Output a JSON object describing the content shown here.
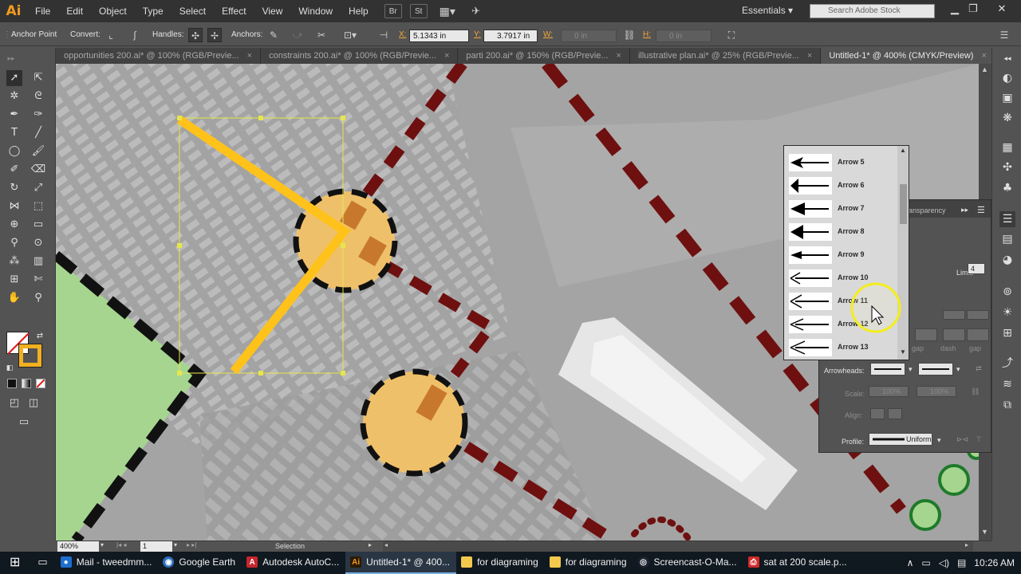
{
  "app": {
    "logo": "Ai",
    "essentials": "Essentials",
    "search_placeholder": "Search Adobe Stock"
  },
  "menu": [
    "File",
    "Edit",
    "Object",
    "Type",
    "Select",
    "Effect",
    "View",
    "Window",
    "Help"
  ],
  "control_bar": {
    "anchor_point": "Anchor Point",
    "convert": "Convert:",
    "handles": "Handles:",
    "anchors": "Anchors:",
    "x_label": "X:",
    "x_value": "5.1343 in",
    "y_label": "Y:",
    "y_value": "3.7917 in",
    "w_label": "W:",
    "w_value": "0 in",
    "h_label": "H:",
    "h_value": "0 in"
  },
  "tabs": [
    {
      "label": "opportunities 200.ai* @ 100% (RGB/Previe...",
      "active": false
    },
    {
      "label": "constraints 200.ai* @ 100% (RGB/Previe...",
      "active": false
    },
    {
      "label": "parti 200.ai* @ 150% (RGB/Previe...",
      "active": false
    },
    {
      "label": "illustrative plan.ai* @ 25% (RGB/Previe...",
      "active": false
    },
    {
      "label": "Untitled-1* @ 400% (CMYK/Preview)",
      "active": true
    }
  ],
  "arrowheads_list": [
    "Arrow 5",
    "Arrow 6",
    "Arrow 7",
    "Arrow 8",
    "Arrow 9",
    "Arrow 10",
    "Arrow 11",
    "Arrow 12",
    "Arrow 13"
  ],
  "stroke_panel": {
    "tab_partial": "ansparency",
    "limit_label": "Limit:",
    "limit_value": "4",
    "dash_labels": [
      "gap",
      "dash",
      "gap"
    ],
    "arrowheads_label": "Arrowheads:",
    "scale_label": "Scale:",
    "scale_1": "100%",
    "scale_2": "100%",
    "align_label": "Align:",
    "profile_label": "Profile:",
    "profile_value": "Uniform"
  },
  "status": {
    "zoom": "400%",
    "artboard": "1",
    "tool": "Selection"
  },
  "taskbar": {
    "tasks": [
      {
        "label": "Mail - tweedmm...",
        "active": false
      },
      {
        "label": "Google Earth",
        "active": false
      },
      {
        "label": "Autodesk AutoC...",
        "active": false
      },
      {
        "label": "Untitled-1* @ 400...",
        "active": true
      },
      {
        "label": "for diagraming",
        "active": false
      },
      {
        "label": "for diagraming",
        "active": false
      },
      {
        "label": "Screencast-O-Ma...",
        "active": false
      },
      {
        "label": "sat at 200 scale.p...",
        "active": false
      }
    ],
    "time": "10:26 AM"
  },
  "colors": {
    "accent": "#f29a1f",
    "path_yellow": "#ffc21a",
    "boundary_red": "#6e1010",
    "green_area": "#a6d58f"
  }
}
